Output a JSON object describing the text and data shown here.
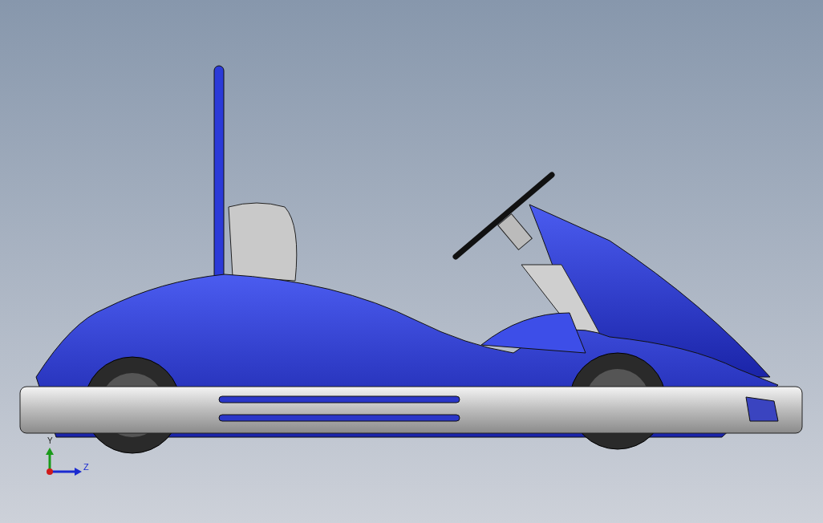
{
  "viewport": {
    "axes": [
      {
        "label": "Y"
      },
      {
        "label": "Z"
      }
    ]
  }
}
